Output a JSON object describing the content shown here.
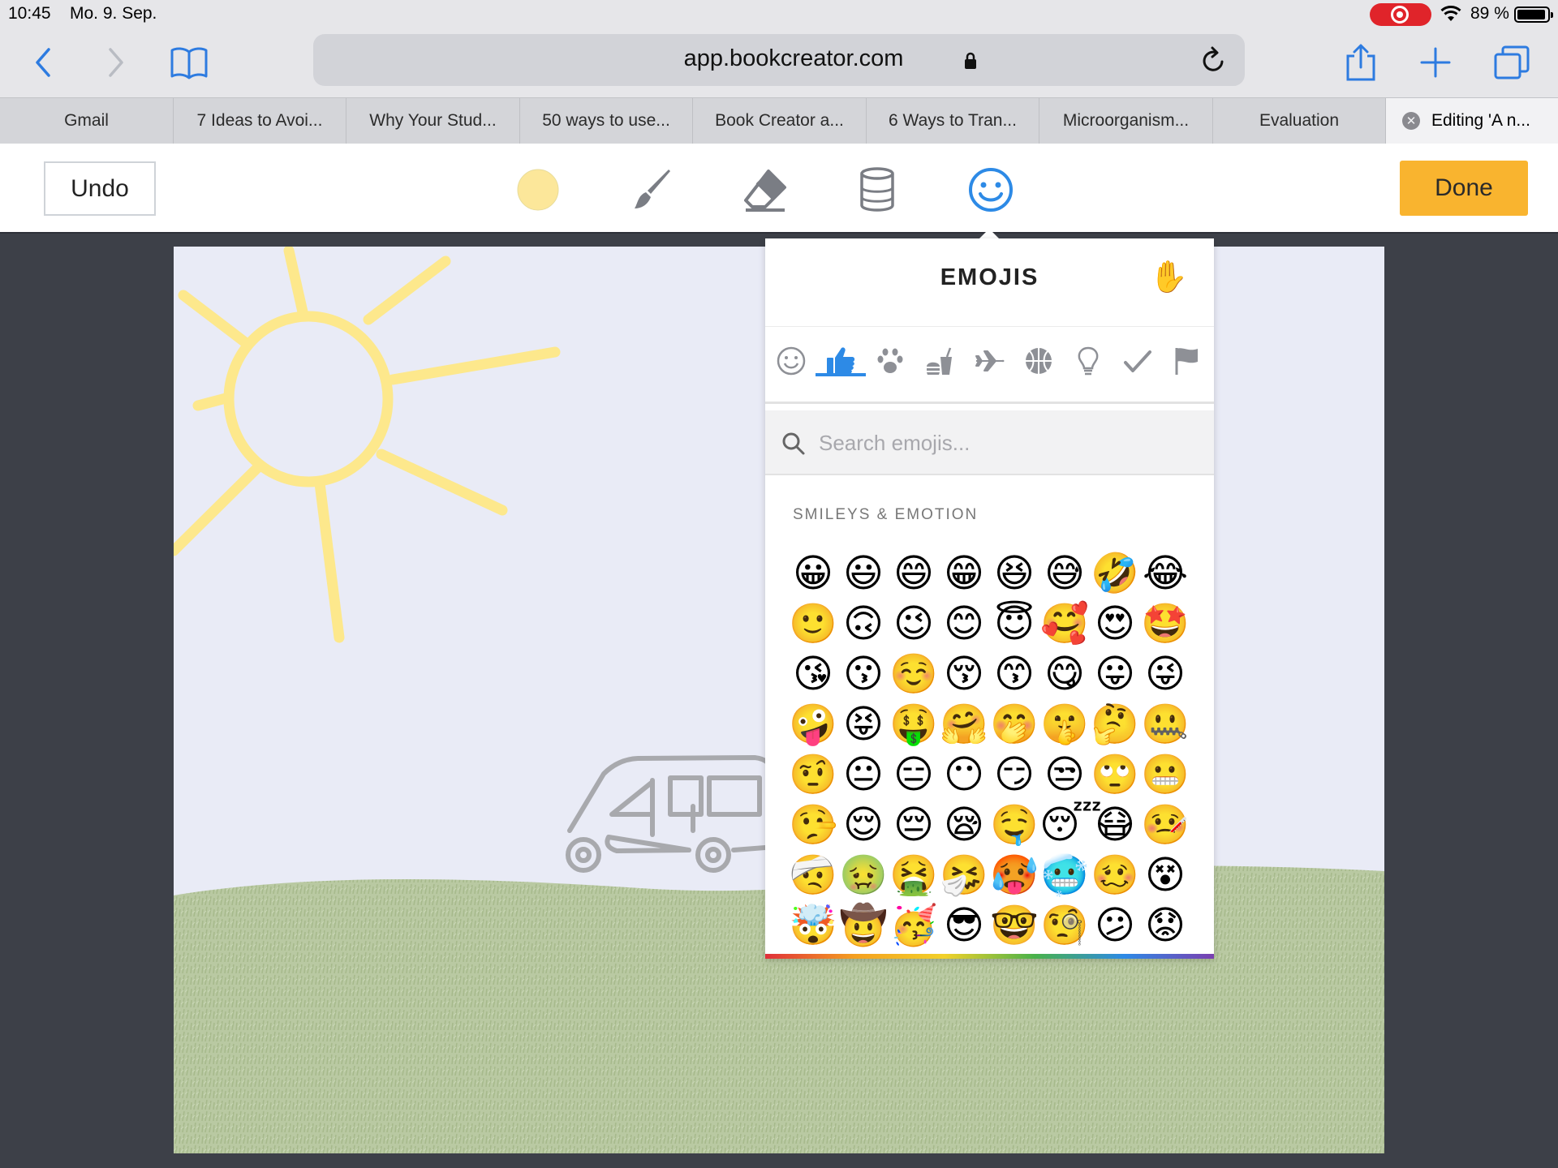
{
  "status_bar": {
    "time": "10:45",
    "date": "Mo. 9. Sep.",
    "battery": "89 %"
  },
  "browser": {
    "url": "app.bookcreator.com",
    "tabs": [
      {
        "title": "Gmail",
        "active": false
      },
      {
        "title": "7 Ideas to Avoi...",
        "active": false
      },
      {
        "title": "Why Your Stud...",
        "active": false
      },
      {
        "title": "50 ways to use...",
        "active": false
      },
      {
        "title": "Book Creator a...",
        "active": false
      },
      {
        "title": "6 Ways to Tran...",
        "active": false
      },
      {
        "title": "Microorganism...",
        "active": false
      },
      {
        "title": "Evaluation",
        "active": false
      },
      {
        "title": "Editing 'A n...",
        "active": true
      }
    ]
  },
  "app_toolbar": {
    "undo_label": "Undo",
    "done_label": "Done",
    "color_swatch": "#fce79a",
    "accent": "#2d8ae6",
    "done_color": "#f9b42f"
  },
  "emoji_panel": {
    "title": "EMOJIS",
    "hand_emoji": "✋",
    "categories": [
      "smiley-icon",
      "thumbs-up-icon",
      "paw-icon",
      "food-icon",
      "airplane-icon",
      "ball-icon",
      "lightbulb-icon",
      "checkmark-icon",
      "flag-icon"
    ],
    "active_category": "thumbs-up-icon",
    "search_placeholder": "Search emojis...",
    "section_title": "SMILEYS & EMOTION",
    "emojis": [
      "😀",
      "😃",
      "😄",
      "😁",
      "😆",
      "😅",
      "🤣",
      "😂",
      "🙂",
      "🙃",
      "😉",
      "😊",
      "😇",
      "🥰",
      "😍",
      "🤩",
      "😘",
      "😗",
      "☺️",
      "😚",
      "😙",
      "😋",
      "😛",
      "😜",
      "🤪",
      "😝",
      "🤑",
      "🤗",
      "🤭",
      "🤫",
      "🤔",
      "🤐",
      "🤨",
      "😐",
      "😑",
      "😶",
      "😏",
      "😒",
      "🙄",
      "😬",
      "🤥",
      "😌",
      "😔",
      "😪",
      "🤤",
      "😴",
      "😷",
      "🤒",
      "🤕",
      "🤢",
      "🤮",
      "🤧",
      "🥵",
      "🥶",
      "🥴",
      "😵",
      "🤯",
      "🤠",
      "🥳",
      "😎",
      "🤓",
      "🧐",
      "😕",
      "😟"
    ]
  }
}
